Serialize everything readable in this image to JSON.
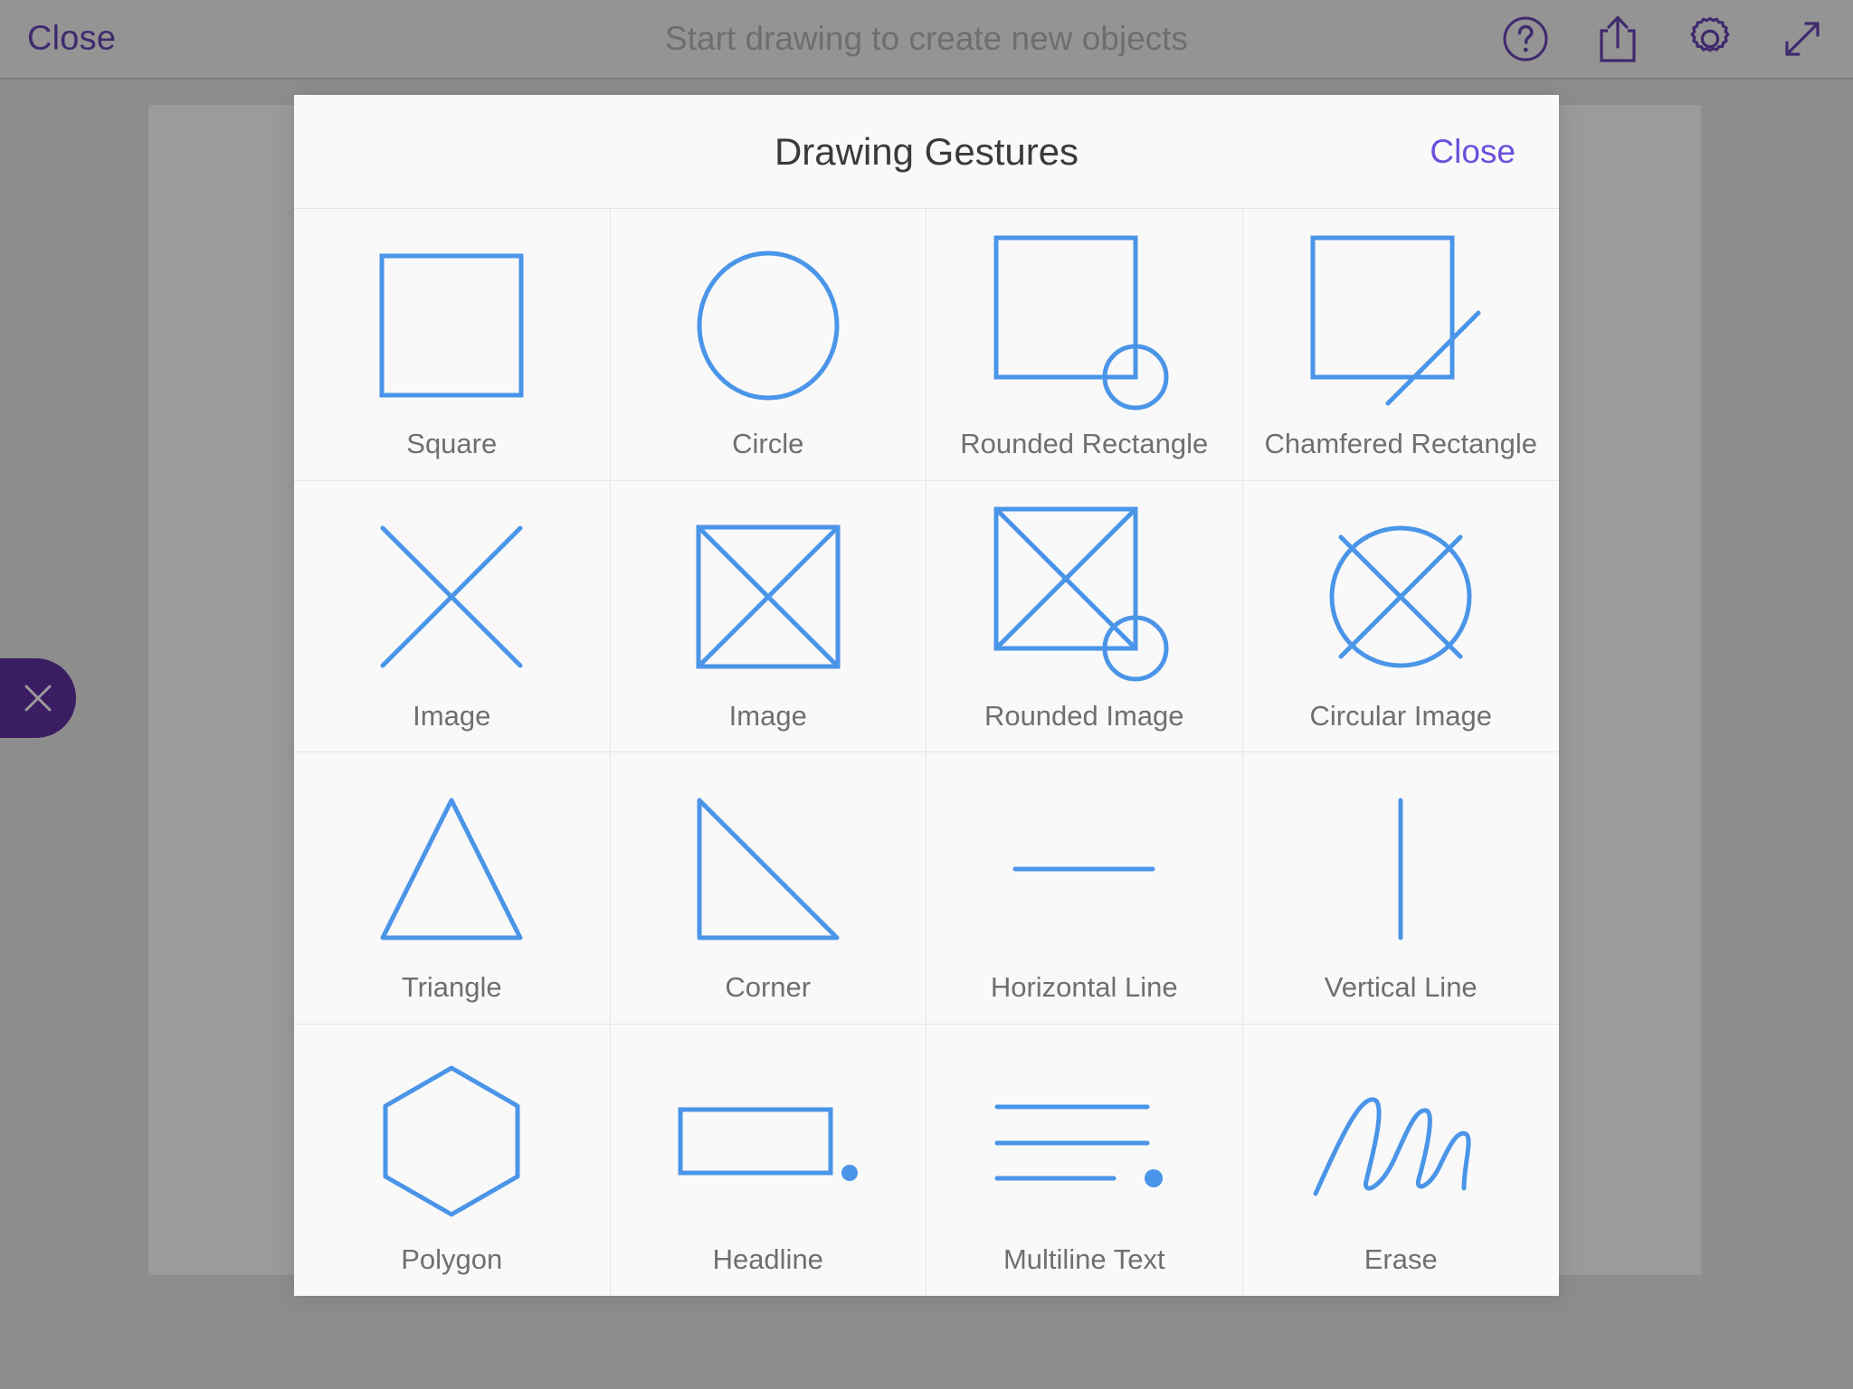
{
  "toolbar": {
    "close_label": "Close",
    "title": "Start drawing to create new objects",
    "icons": [
      {
        "name": "help-icon",
        "label": "Help"
      },
      {
        "name": "share-icon",
        "label": "Share"
      },
      {
        "name": "gear-icon",
        "label": "Settings"
      },
      {
        "name": "expand-icon",
        "label": "Expand"
      }
    ]
  },
  "side_tab": {
    "icon": "close-x-icon",
    "color": "#3b1d63"
  },
  "modal": {
    "title": "Drawing Gestures",
    "close_label": "Close",
    "accent_color": "#6c4fdd",
    "shape_color": "#4a95e8",
    "gestures": [
      {
        "label": "Square",
        "icon": "square-gesture-icon"
      },
      {
        "label": "Circle",
        "icon": "circle-gesture-icon"
      },
      {
        "label": "Rounded Rectangle",
        "icon": "rounded-rectangle-gesture-icon"
      },
      {
        "label": "Chamfered Rectangle",
        "icon": "chamfered-rectangle-gesture-icon"
      },
      {
        "label": "Image",
        "icon": "image-x-gesture-icon"
      },
      {
        "label": "Image",
        "icon": "image-square-gesture-icon"
      },
      {
        "label": "Rounded Image",
        "icon": "rounded-image-gesture-icon"
      },
      {
        "label": "Circular Image",
        "icon": "circular-image-gesture-icon"
      },
      {
        "label": "Triangle",
        "icon": "triangle-gesture-icon"
      },
      {
        "label": "Corner",
        "icon": "corner-gesture-icon"
      },
      {
        "label": "Horizontal Line",
        "icon": "horizontal-line-gesture-icon"
      },
      {
        "label": "Vertical Line",
        "icon": "vertical-line-gesture-icon"
      },
      {
        "label": "Polygon",
        "icon": "polygon-gesture-icon"
      },
      {
        "label": "Headline",
        "icon": "headline-gesture-icon"
      },
      {
        "label": "Multiline Text",
        "icon": "multiline-text-gesture-icon"
      },
      {
        "label": "Erase",
        "icon": "erase-gesture-icon"
      }
    ]
  }
}
